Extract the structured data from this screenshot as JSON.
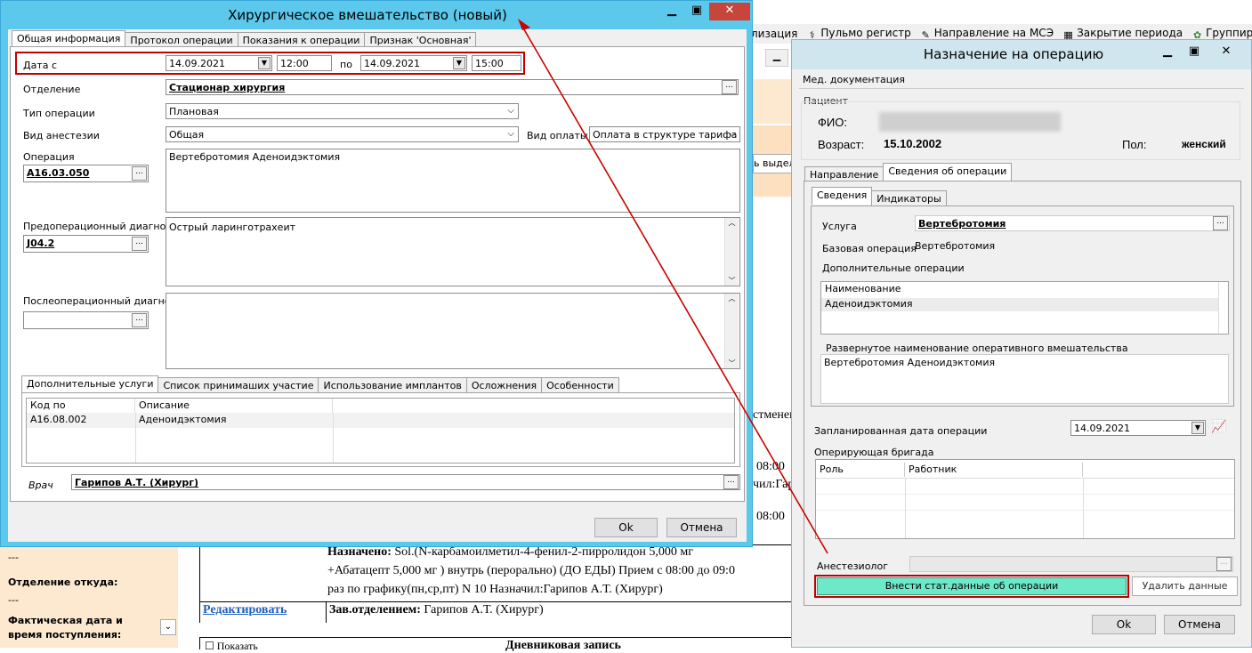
{
  "bg": {
    "toolbar": [
      {
        "label": "лизация",
        "icon": ""
      },
      {
        "label": "Пульмо регистр",
        "icon": "pulmo-icon"
      },
      {
        "label": "Направление на МСЭ",
        "icon": "referral-icon"
      },
      {
        "label": "Закрытие периода",
        "icon": "calendar-icon"
      },
      {
        "label": "Группированные",
        "icon": "group-icon"
      }
    ],
    "side_text_1": "ь выдел",
    "side_text_2": "стменен",
    "side_time_1": "08:00",
    "side_time_2": "чил:Гар",
    "side_time_3": "08:00",
    "left_dash_1": "---",
    "left_label_1": "Отделение откуда:",
    "left_dash_2": "---",
    "left_label_2": "Фактическая дата и время поступления:",
    "assigned_label": "Назначено:",
    "assigned_text_1": " Sol.(N-карбамоилметил-4-фенил-2-пирролидон 5,000 мг",
    "assigned_text_2": "+Абатацепт 5,000 мг ) внутрь (перорально) (ДО ЕДЫ) Прием с 08:00 до 09:0",
    "assigned_text_3": "раз по графику(пн,ср,пт) N 10 Назначил:Гарипов А.Т. (Хирург)",
    "edit_link": "Редактировать",
    "head_label": "Зав.отделением:",
    "head_name": " Гарипов А.Т. (Хирург)",
    "bottom_check": "Показать",
    "bottom_title": "Дневниковая запись"
  },
  "surgery": {
    "title": "Хирургическое вмешательство (новый)",
    "tabs": [
      "Общая информация",
      "Протокол операции",
      "Показания к операции",
      "Признак 'Основная'"
    ],
    "date_label": "Дата с",
    "date_from": "14.09.2021",
    "time_from": "12:00",
    "to_label": "по",
    "date_to": "14.09.2021",
    "time_to": "15:00",
    "dept_label": "Отделение",
    "dept_value": "Стационар  хирургия",
    "optype_label": "Тип операции",
    "optype_value": "Плановая",
    "anesth_label": "Вид анестезии",
    "anesth_value": "Общая",
    "payment_label": "Вид оплаты",
    "payment_value": "Оплата в структуре тарифа",
    "operation_label": "Операция",
    "operation_code": "A16.03.050",
    "operation_text": "Вертебротомия Аденоидэктомия",
    "preop_label": "Предоперационный диагноз",
    "preop_code": "J04.2",
    "preop_text": "Острый ларинготрахеит",
    "postop_label": "Послеоперационный диагноз",
    "subtabs": [
      "Дополнительные услуги",
      "Список принимаших участие",
      "Использование имплантов",
      "Осложнения",
      "Особенности"
    ],
    "grid_headers": [
      "Код по справочнику",
      "Описание"
    ],
    "grid_rows": [
      {
        "code": "A16.08.002",
        "desc": "Аденоидэктомия"
      }
    ],
    "doctor_label": "Врач",
    "doctor_value": "Гарипов А.Т. (Хирург)",
    "ok": "Ok",
    "cancel": "Отмена"
  },
  "assign": {
    "title": "Назначение на операцию",
    "top_tab": "Мед. документация",
    "patient_group": "Пациент",
    "fio_label": "ФИО:",
    "age_label": "Возраст:",
    "age_value": "15.10.2002",
    "sex_label": "Пол:",
    "sex_value": "женский",
    "tabs": [
      "Направление",
      "Сведения об операции"
    ],
    "subtabs": [
      "Сведения",
      "Индикаторы"
    ],
    "service_label": "Услуга",
    "service_value": "Вертебротомия",
    "base_label": "Базовая операция",
    "base_value": "Вертебротомия",
    "extra_label": "Дополнительные операции",
    "extra_header": "Наименование",
    "extra_rows": [
      "Аденоидэктомия"
    ],
    "expanded_label": "Развернутое наименование оперативного вмешательства",
    "expanded_value": "Вертебротомия Аденоидэктомия",
    "planned_label": "Запланированная дата операции",
    "planned_value": "14.09.2021",
    "team_label": "Оперирующая бригада",
    "team_headers": [
      "Роль",
      "Работник"
    ],
    "anesth_label": "Анестезиолог",
    "submit": "Внести стат.данные об операции",
    "delete": "Удалить данные",
    "ok": "Ok",
    "cancel": "Отмена"
  },
  "colors": {
    "title_bg": "#5bc8ec",
    "highlight_red": "#c00000",
    "submit_bg": "#6de8c8",
    "arrow": "#cc0000"
  }
}
